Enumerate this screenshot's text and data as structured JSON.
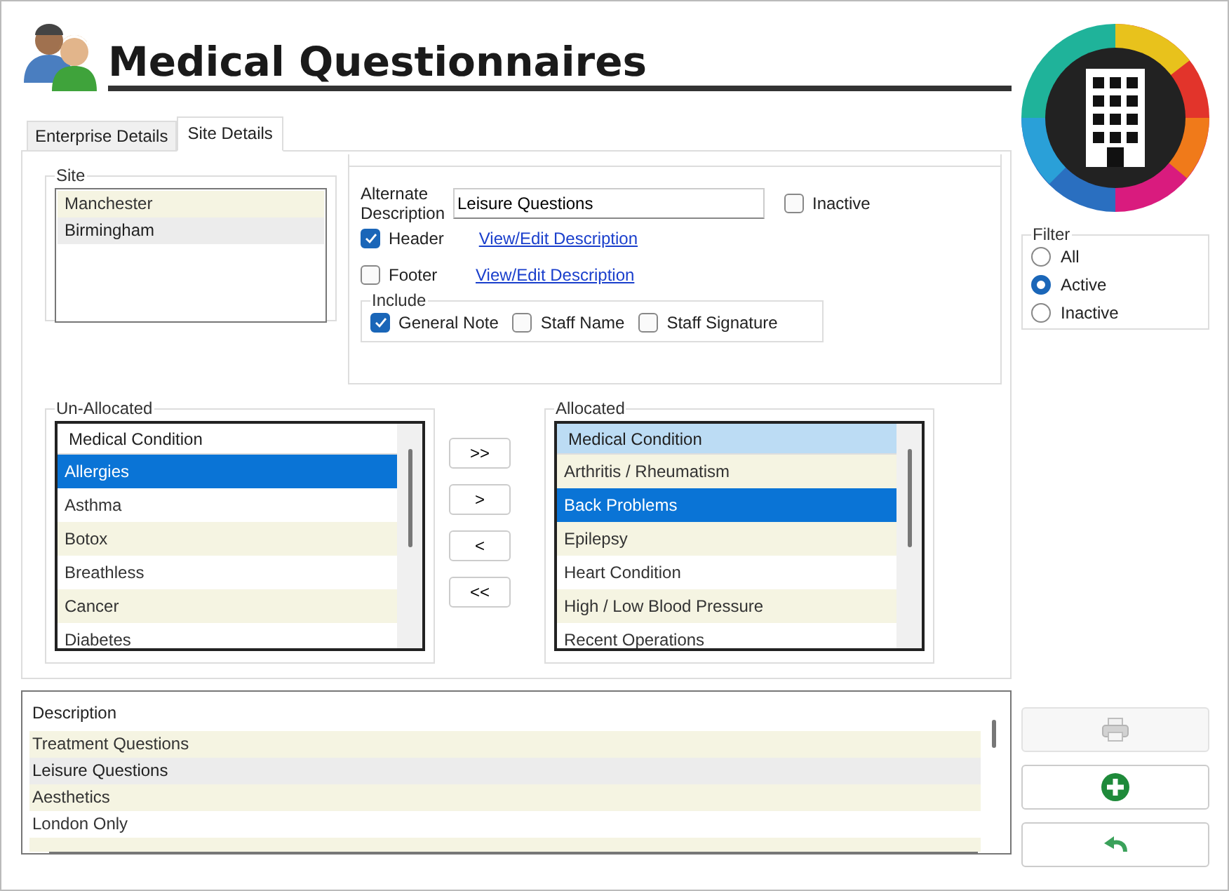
{
  "header": {
    "title": "Medical Questionnaires"
  },
  "tabs": [
    {
      "label": "Enterprise Details",
      "selected": false
    },
    {
      "label": "Site Details",
      "selected": true
    }
  ],
  "site": {
    "legend": "Site",
    "focused": false,
    "items": [
      {
        "label": "Manchester",
        "selected": false
      },
      {
        "label": "Birmingham",
        "selected": true
      }
    ]
  },
  "details": {
    "alternate_label": "Alternate Description",
    "alternate_value": "Leisure Questions",
    "inactive": {
      "label": "Inactive",
      "checked": false
    },
    "header": {
      "label": "Header",
      "checked": true,
      "link": "View/Edit Description"
    },
    "footer": {
      "label": "Footer",
      "checked": false,
      "link": "View/Edit Description"
    },
    "include": {
      "legend": "Include",
      "options": [
        {
          "label": "General Note",
          "checked": true
        },
        {
          "label": "Staff Name",
          "checked": false
        },
        {
          "label": "Staff Signature",
          "checked": false
        }
      ]
    }
  },
  "unallocated": {
    "legend": "Un-Allocated",
    "column": "Medical Condition",
    "header_selected": false,
    "focused": true,
    "items": [
      {
        "label": "Allergies",
        "selected": true
      },
      {
        "label": "Asthma",
        "selected": false
      },
      {
        "label": "Botox",
        "selected": false
      },
      {
        "label": "Breathless",
        "selected": false
      },
      {
        "label": "Cancer",
        "selected": false
      },
      {
        "label": "Diabetes",
        "selected": false
      }
    ]
  },
  "transfer_buttons": [
    ">>",
    ">",
    "<",
    "<<"
  ],
  "allocated": {
    "legend": "Allocated",
    "column": "Medical Condition",
    "header_selected": true,
    "focused": true,
    "items": [
      {
        "label": "Arthritis / Rheumatism",
        "selected": false
      },
      {
        "label": "Back Problems",
        "selected": true
      },
      {
        "label": "Epilepsy",
        "selected": false
      },
      {
        "label": "Heart Condition",
        "selected": false
      },
      {
        "label": "High / Low Blood Pressure",
        "selected": false
      },
      {
        "label": "Recent Operations",
        "selected": false
      }
    ]
  },
  "filter": {
    "legend": "Filter",
    "options": [
      {
        "label": "All",
        "selected": false
      },
      {
        "label": "Active",
        "selected": true
      },
      {
        "label": "Inactive",
        "selected": false
      }
    ]
  },
  "descriptions": {
    "column": "Description",
    "focused": false,
    "items": [
      {
        "label": "Treatment Questions",
        "selected": false
      },
      {
        "label": "Leisure Questions",
        "selected": true
      },
      {
        "label": "Aesthetics",
        "selected": false
      },
      {
        "label": "London Only",
        "selected": false
      }
    ]
  },
  "actions": [
    {
      "kind": "print",
      "disabled": true
    },
    {
      "kind": "add",
      "disabled": false
    },
    {
      "kind": "undo",
      "disabled": false
    }
  ]
}
